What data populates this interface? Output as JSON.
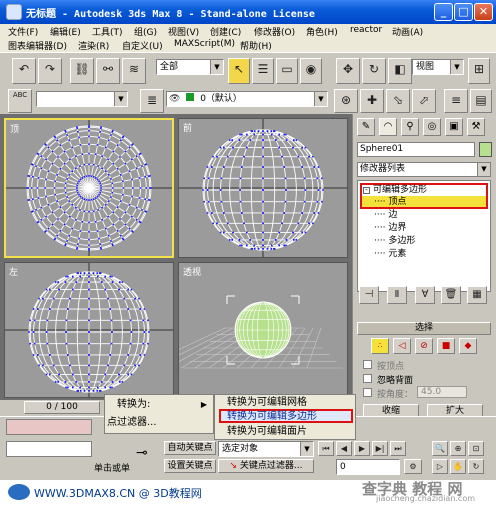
{
  "window": {
    "title": "无标题  - Autodesk 3ds Max 8  - Stand-alone License",
    "min": "_",
    "max": "□",
    "close": "✕"
  },
  "menu1": [
    "文件(F)",
    "编辑(E)",
    "工具(T)",
    "组(G)",
    "视图(V)",
    "创建(C)",
    "修改器(O)",
    "角色(H)",
    "reactor",
    "动画(A)"
  ],
  "menu2": [
    "图表编辑器(D)",
    "渲染(R)",
    "自定义(U)",
    "MAXScript(M)",
    "帮助(H)"
  ],
  "toolbar": {
    "selection_filter": "全部",
    "coord": "视图",
    "layer": "0（默认）",
    "abc_label": "ABC"
  },
  "viewports": {
    "top": "顶",
    "front": "前",
    "left": "左",
    "persp": "透视"
  },
  "panel": {
    "object_name": "Sphere01",
    "modifier_list": "修改器列表",
    "stack": {
      "root": "可编辑多边形",
      "items": [
        "顶点",
        "边",
        "边界",
        "多边形",
        "元素"
      ]
    },
    "selection_title": "选择",
    "by_vertex": "按顶点",
    "ignore_backface": "忽略背面",
    "by_angle": "按角度：",
    "angle_value": "45.0",
    "shrink": "收缩",
    "grow": "扩大",
    "ring": "环形",
    "loop": "循环"
  },
  "timeline": {
    "frame": "0 / 100"
  },
  "context_menu": {
    "convert_to": "转换为:",
    "vertex_filter": "点过滤器..."
  },
  "submenu": {
    "mesh": "转换为可编辑网格",
    "poly": "转换为可编辑多边形",
    "patch": "转换为可编辑面片"
  },
  "bottom": {
    "auto_key": "自动关键点",
    "selected": "选定对象",
    "set_key": "设置关键点",
    "key_filter": "关键点过滤器...",
    "click_or_drag": "单击或单",
    "frame_value": "0"
  },
  "footer": {
    "left": "WWW.3DMAX8.CN @ 3D教程网",
    "watermark": "查字典 教程 网",
    "watermark_url": "jiaocheng.chazidian.com"
  }
}
